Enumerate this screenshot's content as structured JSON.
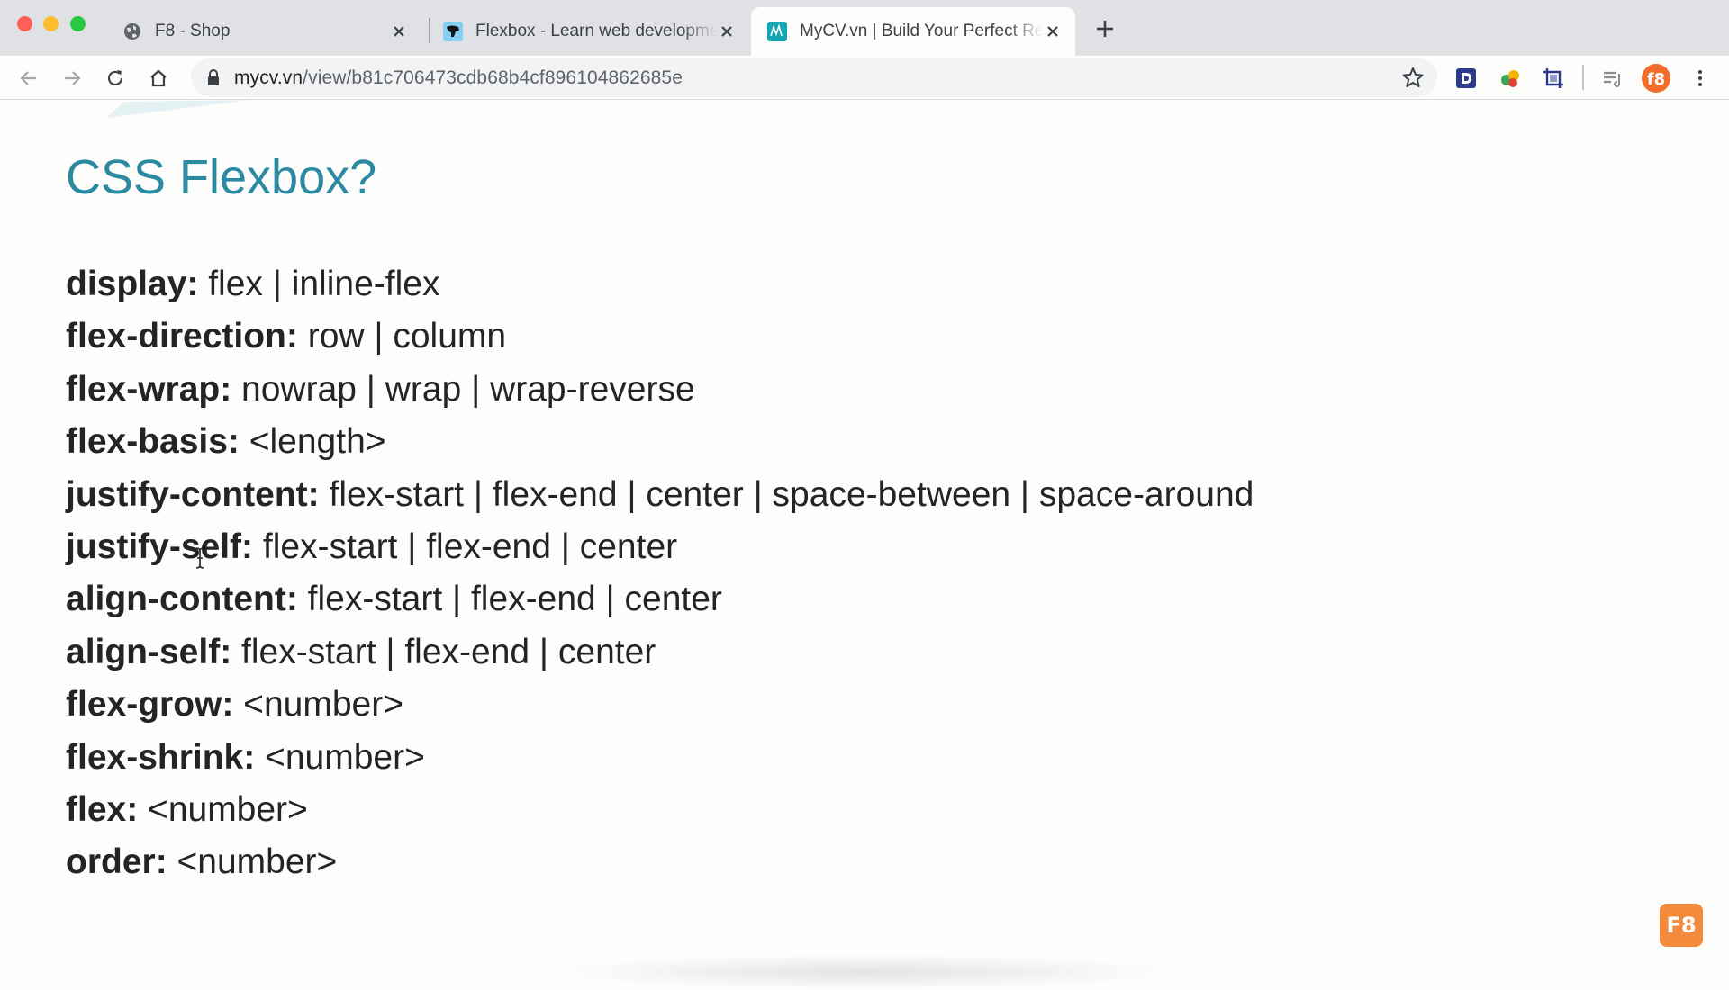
{
  "tabs": [
    {
      "title": "F8 - Shop",
      "favicon": "globe-icon",
      "active": false
    },
    {
      "title": "Flexbox - Learn web development",
      "favicon": "mdn-dino-icon",
      "active": false
    },
    {
      "title": "MyCV.vn | Build Your Perfect Resume",
      "favicon": "mycv-icon",
      "active": true
    }
  ],
  "addressbar": {
    "domain": "mycv.vn",
    "path": "/view/b81c706473cdb68b4cf896104862685e"
  },
  "extensions": [
    "d-extension-icon",
    "color-dots-extension-icon",
    "crop-extension-icon",
    "media-queue-icon",
    "f8-profile-avatar"
  ],
  "content": {
    "heading": "CSS Flexbox?",
    "properties": [
      {
        "key": "display:",
        "value": " flex | inline-flex"
      },
      {
        "key": "flex-direction:",
        "value": " row | column"
      },
      {
        "key": "flex-wrap:",
        "value": " nowrap | wrap | wrap-reverse"
      },
      {
        "key": "flex-basis:",
        "value": " <length>"
      },
      {
        "key": "justify-content:",
        "value": " flex-start | flex-end | center | space-between | space-around"
      },
      {
        "key": "justify-self:",
        "value": " flex-start | flex-end | center"
      },
      {
        "key": "align-content:",
        "value": " flex-start | flex-end | center"
      },
      {
        "key": "align-self:",
        "value": " flex-start | flex-end | center"
      },
      {
        "key": "flex-grow:",
        "value": " <number>"
      },
      {
        "key": "flex-shrink:",
        "value": " <number>"
      },
      {
        "key": "flex:",
        "value": " <number>"
      },
      {
        "key": "order:",
        "value": " <number>"
      }
    ]
  },
  "badge": {
    "label": "F8"
  },
  "colors": {
    "heading": "#2b8aa1",
    "badge": "#f58a3c",
    "text": "#242424"
  }
}
